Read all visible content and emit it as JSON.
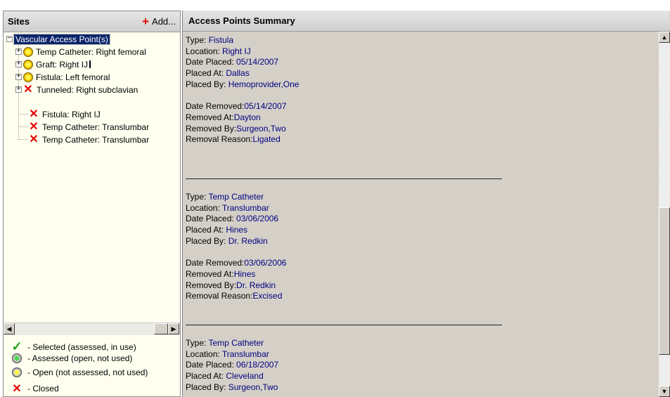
{
  "sites": {
    "title": "Sites",
    "add_label": "Add...",
    "root_label": "Vascular Access Point(s)",
    "items": [
      {
        "label": "Temp Catheter:  Right femoral",
        "icon": "open-dot-icon",
        "expandable": true
      },
      {
        "label": "Graft:  Right IJ",
        "icon": "open-dot-icon",
        "expandable": true
      },
      {
        "label": "Fistula:  Left femoral",
        "icon": "open-dot-icon",
        "expandable": true
      },
      {
        "label": "Tunneled:  Right subclavian",
        "icon": "closed-x-icon",
        "expandable": true
      },
      {
        "label": "Fistula:  Right IJ",
        "icon": "closed-x-icon",
        "expandable": false
      },
      {
        "label": "Temp Catheter:  Translumbar",
        "icon": "closed-x-icon",
        "expandable": false
      },
      {
        "label": "Temp Catheter:  Translumbar",
        "icon": "closed-x-icon",
        "expandable": false
      }
    ]
  },
  "legend": [
    {
      "icon": "checkmark-icon",
      "label": "- Selected (assessed, in use)"
    },
    {
      "icon": "green-dot-icon",
      "label": "- Assessed (open, not used)"
    },
    {
      "icon": "yellow-dot-icon",
      "label": "- Open (not assessed, not used)"
    },
    {
      "icon": "red-x-icon",
      "label": "- Closed"
    }
  ],
  "summary": {
    "title": "Access Points Summary",
    "records": [
      {
        "type_label": "Type: ",
        "type": "Fistula",
        "location_label": "Location: ",
        "location": "Right IJ",
        "placed_date_label": "Date Placed: ",
        "placed_date": "05/14/2007",
        "placed_at_label": "Placed At:  ",
        "placed_at": "Dallas",
        "placed_by_label": "Placed By:  ",
        "placed_by": " Hemoprovider,One",
        "removed_date_label": "Date Removed:",
        "removed_date": "05/14/2007",
        "removed_at_label": "Removed At:",
        "removed_at": "Dayton",
        "removed_by_label": "Removed By:",
        "removed_by": "Surgeon,Two",
        "reason_label": "Removal Reason:",
        "reason": "Ligated"
      },
      {
        "type_label": "Type: ",
        "type": "Temp Catheter",
        "location_label": "Location: ",
        "location": "Translumbar",
        "placed_date_label": "Date Placed: ",
        "placed_date": "03/06/2006",
        "placed_at_label": "Placed At:  ",
        "placed_at": "Hines",
        "placed_by_label": "Placed By:  ",
        "placed_by": "Dr. Redkin",
        "removed_date_label": "Date Removed:",
        "removed_date": "03/06/2006",
        "removed_at_label": "Removed At:",
        "removed_at": "Hines",
        "removed_by_label": "Removed By:",
        "removed_by": "Dr. Redkin",
        "reason_label": "Removal Reason:",
        "reason": "Excised"
      },
      {
        "type_label": "Type: ",
        "type": "Temp Catheter",
        "location_label": "Location: ",
        "location": "Translumbar",
        "placed_date_label": "Date Placed: ",
        "placed_date": "06/18/2007",
        "placed_at_label": "Placed At:  ",
        "placed_at": "Cleveland",
        "placed_by_label": "Placed By:  ",
        "placed_by": " Surgeon,Two"
      }
    ]
  },
  "colors": {
    "value_text": "#00007f",
    "selection": "#0a246a",
    "closed": "#e20000",
    "tree_bg": "#fffff0",
    "pane_bg": "#d4d0c8"
  }
}
